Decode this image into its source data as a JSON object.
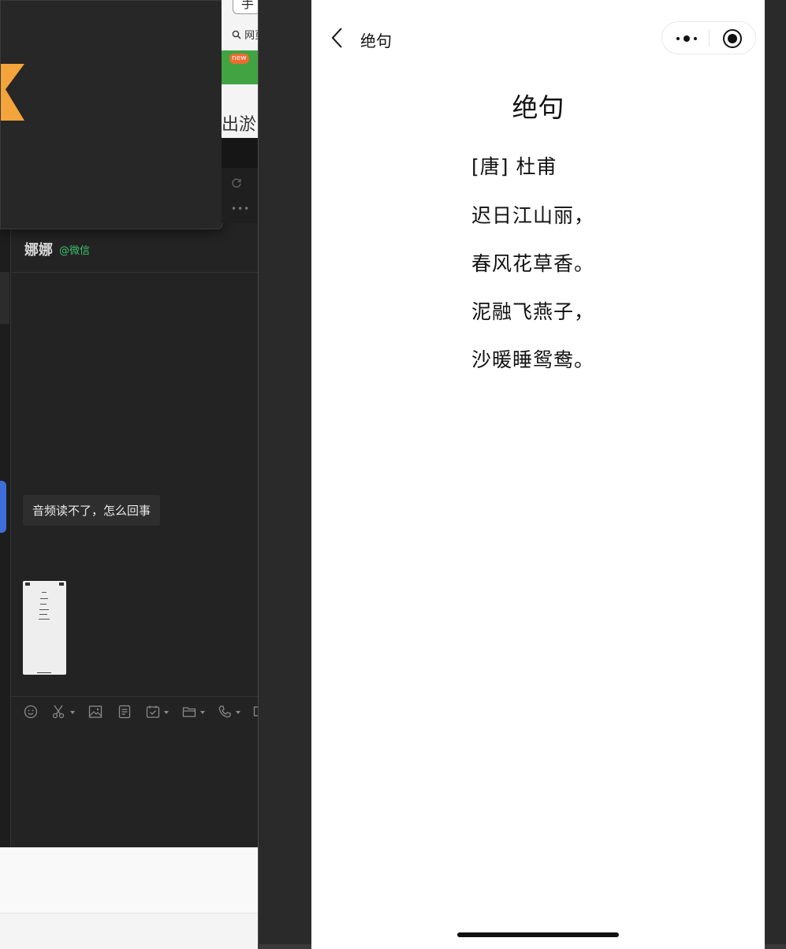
{
  "chat": {
    "contact_name": "娜娜",
    "contact_tag": "@微信",
    "message_text": "音频读不了，怎么回事"
  },
  "toolbar": {
    "icons": [
      "emoji-icon",
      "scissors-icon",
      "image-icon",
      "document-icon",
      "task-icon",
      "folder-icon",
      "phone-icon"
    ]
  },
  "browser": {
    "tab_char": "手",
    "search_text": "网页",
    "badge": "new",
    "page_text": "出淤"
  },
  "miniprogram": {
    "nav_title": "绝句",
    "poem": {
      "title": "绝句",
      "author": "[唐] 杜甫",
      "lines": [
        "迟日江山丽，",
        "春风花草香。",
        "泥融飞燕子，",
        "沙暖睡鸳鸯。"
      ]
    }
  },
  "colors": {
    "chat_bg": "#232323",
    "contact_tag": "#3bbf6a",
    "accent_blue": "#3d6fd8",
    "brand_orange": "#f3a43a",
    "banner_green": "#42a342"
  }
}
